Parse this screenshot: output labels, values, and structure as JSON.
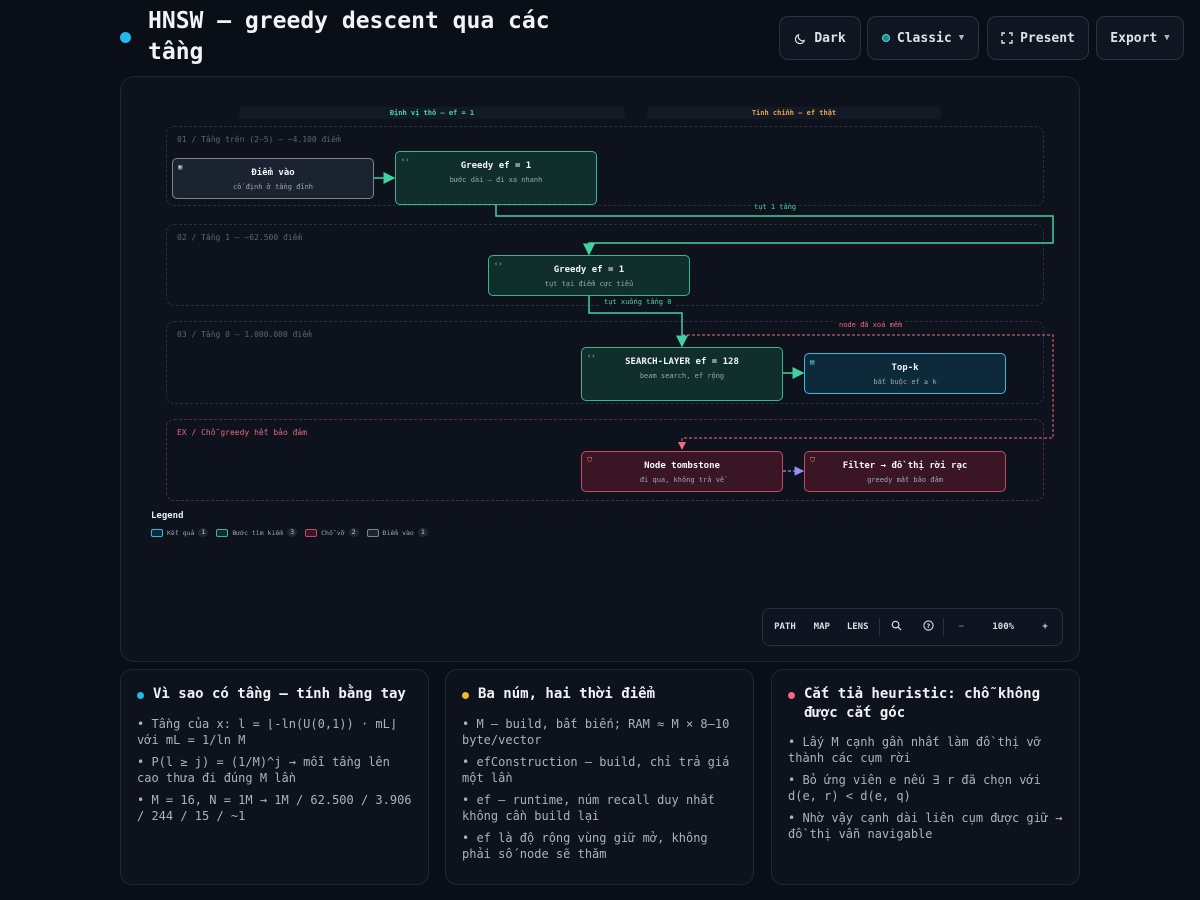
{
  "header": {
    "title": "HNSW — greedy descent qua các tầng",
    "buttons": {
      "dark": "Dark",
      "theme": "Classic",
      "present": "Present",
      "export": "Export"
    }
  },
  "diagram": {
    "phases": {
      "left": "Định vị thô — ef = 1",
      "right": "Tinh chỉnh — ef thật"
    },
    "lanes": {
      "upper": "01 / Tầng trên (2–5) — ~4.100 điểm",
      "layer1": "02 / Tầng 1 — ~62.500 điểm",
      "layer0": "03 / Tầng 0 — 1.000.000 điểm",
      "ex": "EX / Chỗ greedy hết bảo đảm"
    },
    "nodes": {
      "entry": {
        "title": "Điểm vào",
        "sub": "cố định ở tầng đỉnh"
      },
      "greedy_top": {
        "title": "Greedy ef = 1",
        "sub": "bước dài — đi xa nhanh"
      },
      "greedy_l1": {
        "title": "Greedy ef = 1",
        "sub": "tụt tại điểm cực tiểu"
      },
      "search_layer": {
        "title": "SEARCH-LAYER ef = 128",
        "sub": "beam search, ef rộng"
      },
      "topk": {
        "title": "Top-k",
        "sub": "bắt buộc ef ≥ k"
      },
      "tombstone": {
        "title": "Node tombstone",
        "sub": "đi qua, không trả về"
      },
      "filter": {
        "title": "Filter → đồ thị rời rạc",
        "sub": "greedy mất bảo đảm"
      }
    },
    "edge_labels": {
      "descend1": "tụt 1 tầng",
      "descend0": "tụt xuống tầng 0",
      "deleted": "node đã xoá mềm"
    },
    "legend": {
      "title": "Legend",
      "items": [
        {
          "label": "Kết quả",
          "count": "1",
          "color": "#3ab8e0"
        },
        {
          "label": "Bước tìm kiếm",
          "count": "3",
          "color": "#35b98a"
        },
        {
          "label": "Chỗ vỡ",
          "count": "2",
          "color": "#c24a63"
        },
        {
          "label": "Điểm vào",
          "count": "1",
          "color": "#7b8594"
        }
      ]
    },
    "toolbar": {
      "path": "PATH",
      "map": "MAP",
      "lens": "LENS",
      "zoom_out": "−",
      "zoom": "100%",
      "zoom_in": "+"
    }
  },
  "cards": [
    {
      "title": "Vì sao có tầng — tính bằng tay",
      "color": "#22b8f0",
      "bullets": [
        "• Tầng của x: l = ⌊-ln(U(0,1)) · mL⌋ với mL = 1/ln M",
        "• P(l ≥ j) = (1/M)^j → mỗi tầng lên cao thưa đi đúng M lần",
        "• M = 16, N = 1M → 1M / 62.500 / 3.906 / 244 / 15 / ~1"
      ]
    },
    {
      "title": "Ba núm, hai thời điểm",
      "color": "#f5b52e",
      "bullets": [
        "• M — build, bất biến; RAM ≈ M × 8–10 byte/vector",
        "• efConstruction — build, chỉ trả giá một lần",
        "• ef — runtime, núm recall duy nhất không cần build lại",
        "• ef là độ rộng vùng giữ mở, không phải số node sẽ thăm"
      ]
    },
    {
      "title": "Cắt tỉa heuristic: chỗ không được cắt góc",
      "color": "#f06a80",
      "bullets": [
        "• Lấy M cạnh gần nhất làm đồ thị vỡ thành các cụm rời",
        "• Bỏ ứng viên e nếu ∃ r đã chọn với d(e, r) < d(e, q)",
        "• Nhờ vậy cạnh dài liên cụm được giữ → đồ thị vẫn navigable"
      ]
    }
  ]
}
